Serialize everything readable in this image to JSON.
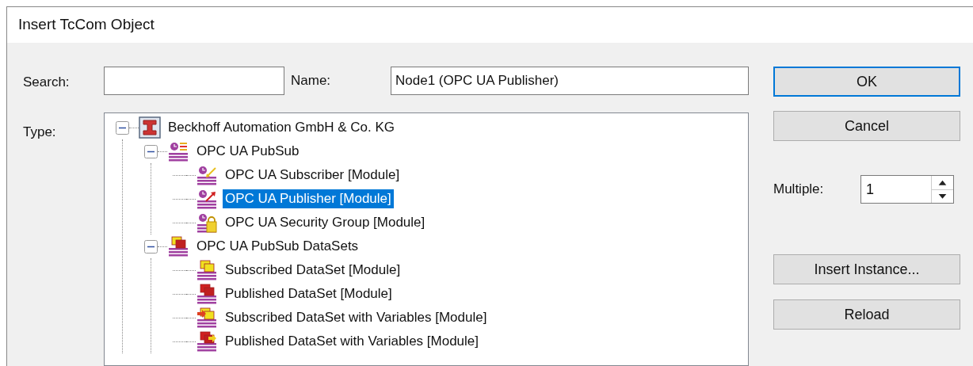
{
  "window": {
    "title": "Insert TcCom Object"
  },
  "search": {
    "label": "Search:"
  },
  "name": {
    "label": "Name:",
    "value": "Node1 (OPC UA Publisher)"
  },
  "type_label": "Type:",
  "tree": [
    {
      "label": "Beckhoff Automation GmbH & Co. KG",
      "kind": "vendor",
      "selected": false,
      "expanded": true,
      "children": [
        {
          "label": "OPC UA PubSub",
          "kind": "pubsub",
          "selected": false,
          "expanded": true,
          "children": [
            {
              "label": "OPC UA Subscriber [Module]",
              "kind": "subscriber",
              "selected": false
            },
            {
              "label": "OPC UA Publisher [Module]",
              "kind": "publisher",
              "selected": true
            },
            {
              "label": "OPC UA Security Group [Module]",
              "kind": "security",
              "selected": false
            }
          ]
        },
        {
          "label": "OPC UA PubSub DataSets",
          "kind": "datasets",
          "selected": false,
          "expanded": true,
          "children": [
            {
              "label": "Subscribed DataSet [Module]",
              "kind": "sub-dataset",
              "selected": false
            },
            {
              "label": "Published DataSet [Module]",
              "kind": "pub-dataset",
              "selected": false
            },
            {
              "label": "Subscribed DataSet with Variables [Module]",
              "kind": "sub-dataset-vars",
              "selected": false
            },
            {
              "label": "Published DataSet with Variables [Module]",
              "kind": "pub-dataset-vars",
              "selected": false
            }
          ]
        }
      ]
    }
  ],
  "buttons": [
    {
      "label": "OK",
      "default": true
    },
    {
      "label": "Cancel",
      "default": false
    }
  ],
  "multiple": {
    "label": "Multiple:",
    "value": "1"
  },
  "side_buttons": [
    {
      "label": "Insert Instance..."
    },
    {
      "label": "Reload"
    }
  ]
}
